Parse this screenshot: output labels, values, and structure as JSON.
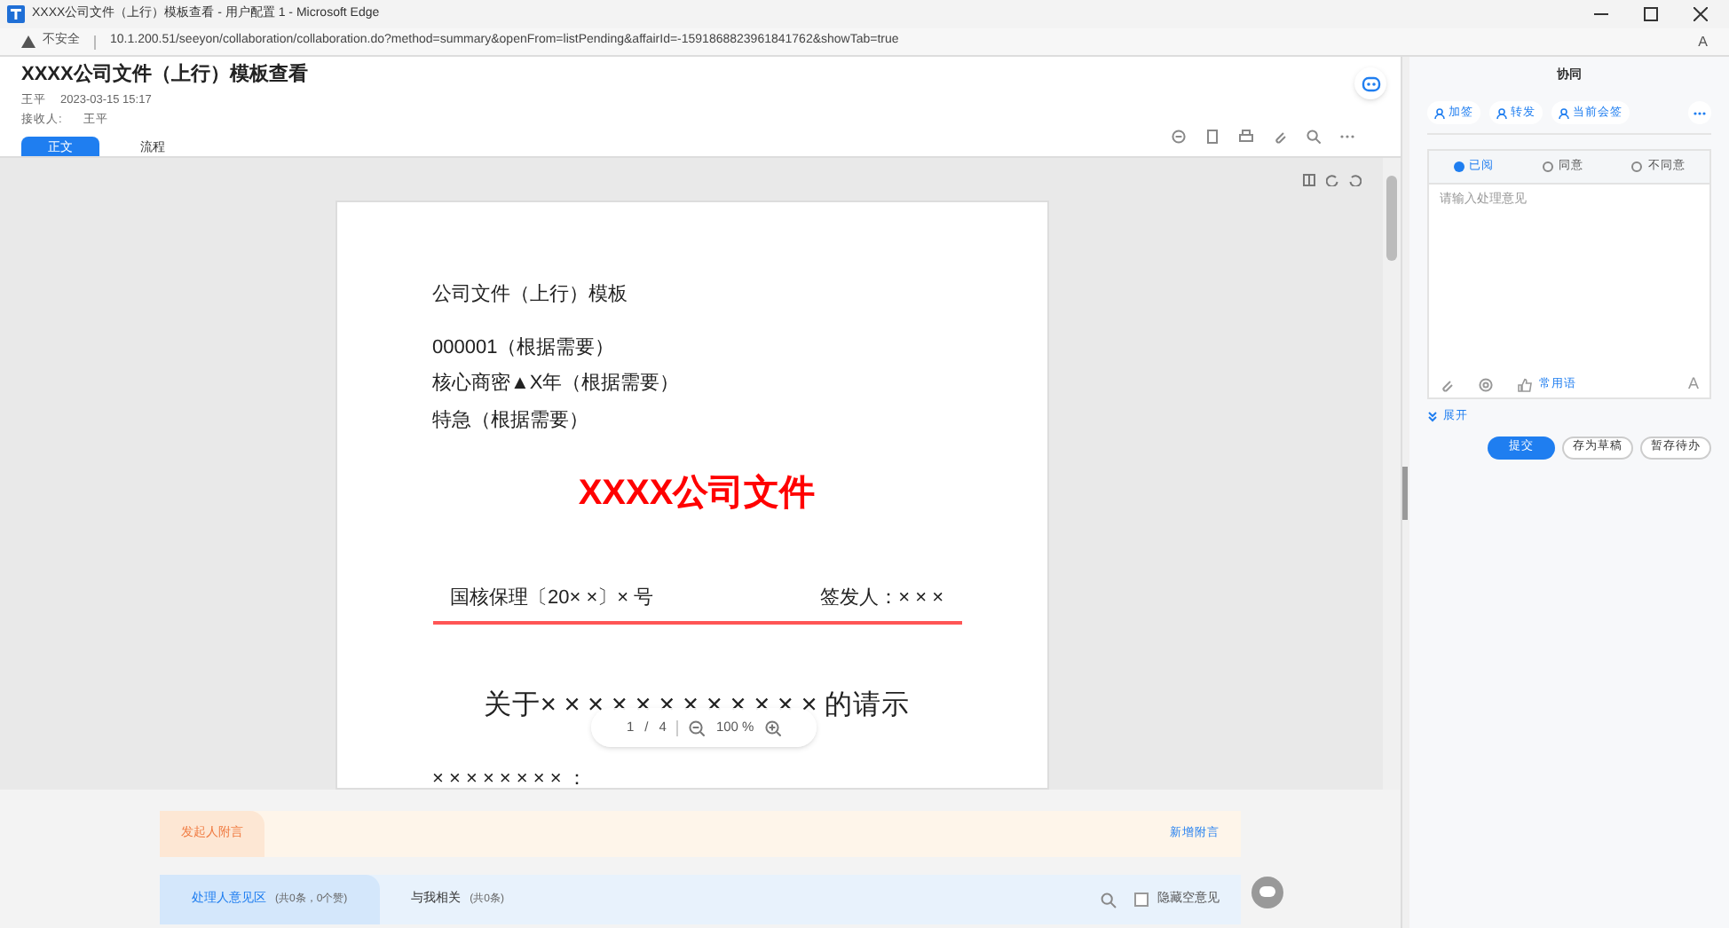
{
  "window": {
    "title": "XXXX公司文件（上行）模板查看 - 用户配置 1 - Microsoft Edge"
  },
  "address_bar": {
    "security": "不安全",
    "url": "10.1.200.51/seeyon/collaboration/collaboration.do?method=summary&openFrom=listPending&affairId=-1591868823961841762&showTab=true",
    "read_aloud": "A"
  },
  "header": {
    "title": "XXXX公司文件（上行）模板查看",
    "author": "王平",
    "time": "2023-03-15 15:17",
    "recipient_label": "接收人:",
    "recipient": "王平"
  },
  "tabs": [
    {
      "label": "正文",
      "selected": true
    },
    {
      "label": "流程",
      "selected": false
    }
  ],
  "document": {
    "heading": "公司文件（上行）模板",
    "lines": [
      "000001（根据需要）",
      "核心商密▲X年（根据需要）",
      "特急（根据需要）"
    ],
    "red_title": "XXXX公司文件",
    "doc_number": "国核保理〔20× ×〕× 号",
    "signer": "签发人：× × ×",
    "subject": "关于× × × × × × × × × × × × 的请示",
    "salutation": "× × × × × × × × ："
  },
  "page_nav": {
    "page": "1",
    "separator": "/",
    "total": "4",
    "zoom": "100 %"
  },
  "sender_note": {
    "label": "发起人附言",
    "link": "新增附言"
  },
  "comment_tabs": [
    {
      "label": "处理人意见区",
      "count": "(共0条，0个赞)",
      "selected": true
    },
    {
      "label": "与我相关",
      "count": "(共0条)",
      "selected": false
    }
  ],
  "hide_empty": {
    "label": "隐藏空意见",
    "checked": false
  },
  "side_panel": {
    "title": "协同",
    "actions": [
      "加签",
      "转发",
      "当前会签"
    ],
    "attitudes": [
      {
        "label": "已阅",
        "selected": true
      },
      {
        "label": "同意",
        "selected": false
      },
      {
        "label": "不同意",
        "selected": false
      }
    ],
    "placeholder": "请输入处理意见",
    "phrases": "常用语",
    "font_button": "A",
    "expand": "展开",
    "buttons": [
      {
        "label": "提交",
        "kind": "primary"
      },
      {
        "label": "存为草稿",
        "kind": "secondary"
      },
      {
        "label": "暂存待办",
        "kind": "secondary"
      }
    ]
  }
}
